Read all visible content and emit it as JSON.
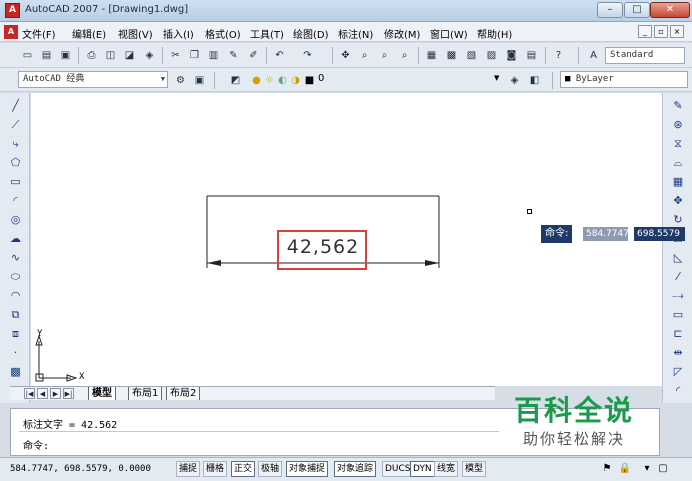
{
  "window": {
    "title": "AutoCAD 2007 - [Drawing1.dwg]",
    "app_icon": "autocad-logo",
    "controls": [
      "minimize",
      "maximize",
      "close"
    ]
  },
  "menubar": {
    "items": [
      "文件(F)",
      "编辑(E)",
      "视图(V)",
      "插入(I)",
      "格式(O)",
      "工具(T)",
      "绘图(D)",
      "标注(N)",
      "修改(M)",
      "窗口(W)",
      "帮助(H)"
    ],
    "mdi_controls": [
      "minimize",
      "restore",
      "close"
    ]
  },
  "toolbar": {
    "text_style": "Standard",
    "workspace": "AutoCAD 经典",
    "layer": "0",
    "linetype": "ByLayer"
  },
  "drawing": {
    "dimension_value": "42,562",
    "highlight_color": "#d9403a",
    "ucs_x": "X",
    "ucs_y": "Y"
  },
  "dynamic_input": {
    "prompt": "命令:",
    "x_value": "584.7747",
    "y_value": "698.5579"
  },
  "layout_tabs": {
    "items": [
      "模型",
      "布局1",
      "布局2"
    ],
    "active": "模型"
  },
  "command_window": {
    "history": "标注文字 = 42.562",
    "prompt": "命令:"
  },
  "watermark": {
    "title": "百科全说",
    "subtitle": "助你轻松解决",
    "color": "#1a9a4a"
  },
  "statusbar": {
    "coordinates": "584.7747, 698.5579, 0.0000",
    "toggles": [
      "捕捉",
      "栅格",
      "正交",
      "极轴",
      "对象捕捉",
      "对象追踪",
      "DUCS",
      "DYN",
      "线宽",
      "模型"
    ]
  }
}
